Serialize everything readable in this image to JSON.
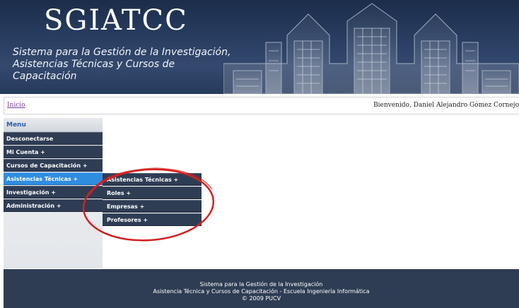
{
  "header": {
    "title": "SGIATCC",
    "subtitle_line1": "Sistema para la Gestión de la Investigación,",
    "subtitle_line2": "Asistencias Técnicas y Cursos de Capacitación"
  },
  "breadcrumb": {
    "home": "Inicio"
  },
  "welcome_text": "Bienvenido, Daniel Alejandro Gómez Cornejo",
  "sidebar": {
    "heading": "Menu",
    "items": [
      {
        "label": "Desconectarse"
      },
      {
        "label": "Mi Cuenta +"
      },
      {
        "label": "Cursos de Capacitación +"
      },
      {
        "label": "Asistencias Técnicas +",
        "active": true
      },
      {
        "label": "Investigación +"
      },
      {
        "label": "Administración +"
      }
    ]
  },
  "submenu": {
    "items": [
      {
        "label": "Asistencias Técnicas +"
      },
      {
        "label": "Roles +"
      },
      {
        "label": "Empresas +"
      },
      {
        "label": "Profesores +"
      }
    ]
  },
  "footer": {
    "line1": "Sistema para la Gestión de la Investigación",
    "line2": "Asistencia Técnica y Cursos de Capacitación - Escuela Ingeniería Informática",
    "line3": "© 2009 PUCV"
  },
  "colors": {
    "menu_bg": "#2f3d54",
    "menu_active": "#2f8de0",
    "annotation_circle": "#d62020",
    "header_bg": "#2a3f63",
    "link": "#7b3f9a"
  }
}
